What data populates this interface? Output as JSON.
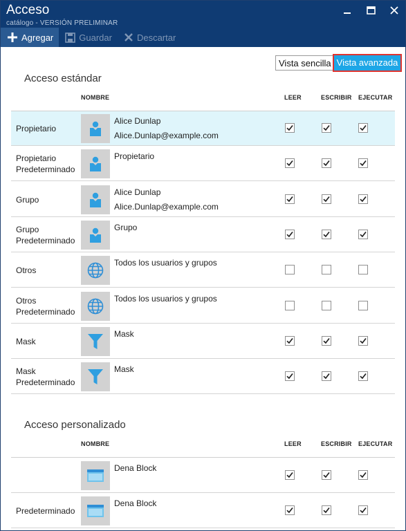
{
  "window": {
    "title": "Acceso",
    "subtitle": "catálogo - VERSIÓN PRELIMINAR",
    "buttons": [
      "minimize-icon",
      "maximize-icon",
      "close-icon"
    ]
  },
  "toolbar": {
    "add_label": "Agregar",
    "save_label": "Guardar",
    "discard_label": "Descartar"
  },
  "view_toggle": {
    "simple_label": "Vista sencilla",
    "advanced_label": "Vista avanzada",
    "selected": "advanced"
  },
  "colors": {
    "header": "#0f3b73",
    "accent": "#1ea6e6",
    "selected_row": "#dff5fb",
    "highlight_border": "#e0332f"
  },
  "standard": {
    "title": "Acceso estándar",
    "headers": {
      "name": "NOMBRE",
      "read": "LEER",
      "write": "ESCRIBIR",
      "execute": "EJECUTAR"
    },
    "rows": [
      {
        "type": "Propietario",
        "icon": "user-icon",
        "name": "Alice Dunlap",
        "email": "Alice.Dunlap@example.com",
        "read": true,
        "write": true,
        "execute": true,
        "selected": true
      },
      {
        "type": "Propietario Predeterminado",
        "icon": "user-icon",
        "name": "Propietario",
        "email": "",
        "read": true,
        "write": true,
        "execute": true
      },
      {
        "type": "Grupo",
        "icon": "user-icon",
        "name": "Alice Dunlap",
        "email": "Alice.Dunlap@example.com",
        "read": true,
        "write": true,
        "execute": true
      },
      {
        "type": "Grupo Predeterminado",
        "icon": "user-icon",
        "name": "Grupo",
        "email": "",
        "read": true,
        "write": true,
        "execute": true
      },
      {
        "type": "Otros",
        "icon": "globe-icon",
        "name": "Todos los usuarios y grupos",
        "email": "",
        "read": false,
        "write": false,
        "execute": false
      },
      {
        "type": "Otros Predeterminado",
        "icon": "globe-icon",
        "name": "Todos los usuarios y grupos",
        "email": "",
        "read": false,
        "write": false,
        "execute": false
      },
      {
        "type": "Mask",
        "icon": "filter-icon",
        "name": "Mask",
        "email": "",
        "read": true,
        "write": true,
        "execute": true
      },
      {
        "type": "Mask Predeterminado",
        "icon": "filter-icon",
        "name": "Mask",
        "email": "",
        "read": true,
        "write": true,
        "execute": true
      }
    ]
  },
  "custom": {
    "title": "Acceso personalizado",
    "headers": {
      "name": "NOMBRE",
      "read": "LEER",
      "write": "ESCRIBIR",
      "execute": "EJECUTAR"
    },
    "rows": [
      {
        "type": "",
        "icon": "window-icon",
        "name": "Dena Block",
        "email": "",
        "read": true,
        "write": true,
        "execute": true
      },
      {
        "type": "Predeterminado",
        "icon": "window-icon",
        "name": "Dena Block",
        "email": "",
        "read": true,
        "write": true,
        "execute": true
      }
    ]
  }
}
